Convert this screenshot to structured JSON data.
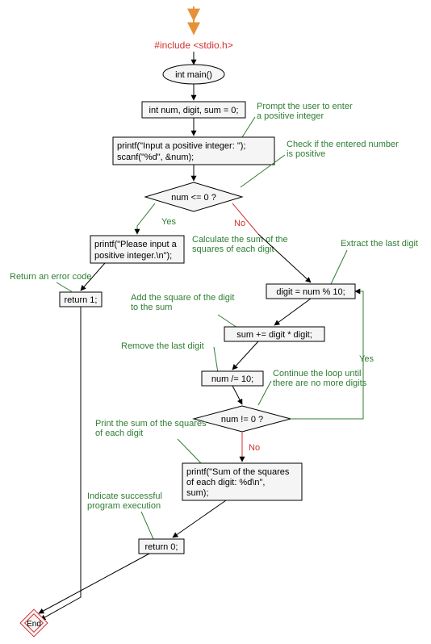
{
  "flow": {
    "include": "#include <stdio.h>",
    "main": "int main()",
    "declare": "int num, digit, sum = 0;",
    "prompt_block_line1": "printf(\"Input a positive integer: \");",
    "prompt_block_line2": "scanf(\"%d\", &num);",
    "cond_num_le0": "num <= 0 ?",
    "yes1": "Yes",
    "no1": "No",
    "please_line1": "printf(\"Please input a",
    "please_line2": "positive integer.\\n\");",
    "return1": "return 1;",
    "digit_assign": "digit = num % 10;",
    "sum_add": "sum += digit * digit;",
    "num_div": "num /= 10;",
    "cond_num_ne0": "num != 0 ?",
    "yes2": "Yes",
    "no2": "No",
    "printf_sum_line1": "printf(\"Sum of the squares",
    "printf_sum_line2": "of each digit: %d\\n\",",
    "printf_sum_line3": "sum);",
    "return0": "return 0;",
    "end": "End"
  },
  "comments": {
    "prompt": "Prompt the user to enter a positive integer",
    "check": "Check if the entered number is positive",
    "return_err": "Return an error code",
    "calc": "Calculate the sum of the squares of each digit",
    "extract": "Extract the last digit",
    "addsq": "Add the square of the digit to the sum",
    "remove": "Remove the last digit",
    "cont": "Continue the loop until there are no more digits",
    "print": "Print the sum of the squares of each digit",
    "success": "Indicate successful program execution"
  },
  "colors": {
    "red": "#d32f2f",
    "green": "#2e7d32",
    "black": "#000000",
    "node_fill": "#f5f5f5"
  },
  "chart_data": {
    "type": "flowchart",
    "nodes": [
      {
        "id": "start",
        "shape": "arrow-down"
      },
      {
        "id": "include",
        "shape": "text",
        "text": "#include <stdio.h>"
      },
      {
        "id": "main",
        "shape": "ellipse",
        "text": "int main()"
      },
      {
        "id": "declare",
        "shape": "rect",
        "text": "int num, digit, sum = 0;"
      },
      {
        "id": "input",
        "shape": "rect",
        "text": "printf(\"Input a positive integer: \"); scanf(\"%d\", &num);"
      },
      {
        "id": "cond1",
        "shape": "diamond",
        "text": "num <= 0 ?"
      },
      {
        "id": "please",
        "shape": "rect",
        "text": "printf(\"Please input a positive integer.\\n\");"
      },
      {
        "id": "return1",
        "shape": "rect",
        "text": "return 1;"
      },
      {
        "id": "digit",
        "shape": "rect",
        "text": "digit = num % 10;"
      },
      {
        "id": "sumadd",
        "shape": "rect",
        "text": "sum += digit * digit;"
      },
      {
        "id": "numdiv",
        "shape": "rect",
        "text": "num /= 10;"
      },
      {
        "id": "cond2",
        "shape": "diamond",
        "text": "num != 0 ?"
      },
      {
        "id": "printfsum",
        "shape": "rect",
        "text": "printf(\"Sum of the squares of each digit: %d\\n\", sum);"
      },
      {
        "id": "return0",
        "shape": "rect",
        "text": "return 0;"
      },
      {
        "id": "end",
        "shape": "end",
        "text": "End"
      }
    ],
    "edges": [
      {
        "from": "start",
        "to": "include"
      },
      {
        "from": "include",
        "to": "main"
      },
      {
        "from": "main",
        "to": "declare"
      },
      {
        "from": "declare",
        "to": "input"
      },
      {
        "from": "input",
        "to": "cond1"
      },
      {
        "from": "cond1",
        "to": "please",
        "label": "Yes"
      },
      {
        "from": "please",
        "to": "return1"
      },
      {
        "from": "return1",
        "to": "end"
      },
      {
        "from": "cond1",
        "to": "digit",
        "label": "No"
      },
      {
        "from": "digit",
        "to": "sumadd"
      },
      {
        "from": "sumadd",
        "to": "numdiv"
      },
      {
        "from": "numdiv",
        "to": "cond2"
      },
      {
        "from": "cond2",
        "to": "digit",
        "label": "Yes"
      },
      {
        "from": "cond2",
        "to": "printfsum",
        "label": "No"
      },
      {
        "from": "printfsum",
        "to": "return0"
      },
      {
        "from": "return0",
        "to": "end"
      }
    ]
  }
}
